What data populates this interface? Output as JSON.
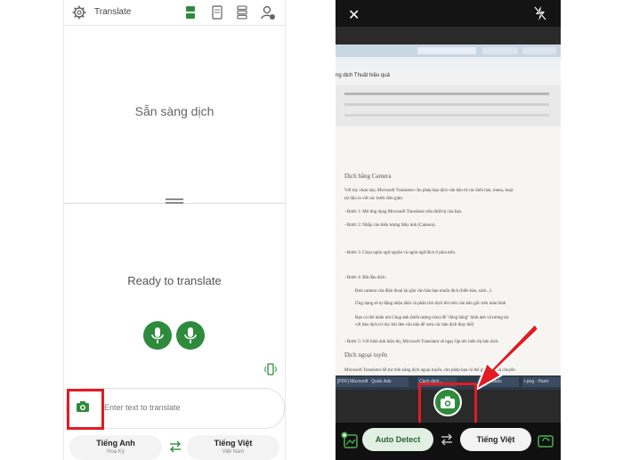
{
  "left_screen": {
    "header": {
      "title": "Translate",
      "icons": [
        "gear-icon",
        "conversation-layout-icon",
        "single-view-icon",
        "stacked-view-icon",
        "profile-settings-icon"
      ]
    },
    "top_pane": {
      "status_text": "Sẵn sàng dịch"
    },
    "bottom_pane": {
      "status_text": "Ready to translate"
    },
    "input": {
      "placeholder": "Enter text to translate",
      "icon": "camera-icon"
    },
    "languages": {
      "source": {
        "name": "Tiếng Anh",
        "region": "Hoa Kỳ"
      },
      "target": {
        "name": "Tiếng Việt",
        "region": "Việt Nam"
      }
    }
  },
  "right_screen": {
    "photographed_document": {
      "heading": "Dịch bằng Camera",
      "lines": [
        "Với tùy chọn này, Microsoft Translator cho phép bạn dịch văn bản từ các biển báo, menu, hoặc",
        "tài liệu in với các bước đơn giản:",
        "- Bước 1: Mở ứng dụng Microsoft Translator trên thiết bị của bạn.",
        "- Bước 2: Nhấp vào biểu tượng Máy ảnh (Camera).",
        "- Bước 3: Chọn ngôn ngữ nguồn và ngôn ngữ đích ở phía trên.",
        "- Bước 4: Bắt đầu dịch:",
        "Đưa camera của điện thoại lại gần văn bản bạn muốn dịch (biển báo, sách...)",
        "Ứng dụng sẽ tự động nhận diện và phân tích dịch lên trên văn bản gốc trên màn hình",
        "Bạn có thể nhấn nút Chụp ảnh (biểu tượng tròn) để \"đóng băng\" hình ảnh và tương tác",
        "với bản dịch (ví dụ: bôi đen văn bản để xem các bản dịch thay thế)",
        "- Bước 5: Với hình ảnh hiện thị, Microsoft Translator sẽ ngay lập tức hiển thị bản dịch.",
        "Dịch ngoại tuyến",
        "Microsoft Translator hỗ trợ tính năng dịch ngoại tuyến, cho phép bạn có thể giao tiếp và chuyển"
      ],
      "doc_title": "ng dịch Thuật hiệu quả",
      "tabs": [
        "[PDF] Microsoft Translator",
        "Quick Ads",
        "Đăng nhập",
        "Cách dịch...",
        "Downloads",
        "t.png - Paint"
      ]
    },
    "controls": {
      "close_icon": "close-icon",
      "flash_icon": "flash-off-icon",
      "shutter_icon": "camera-icon",
      "source_button": "Auto Detect",
      "target_button": "Tiếng Việt"
    }
  },
  "colors": {
    "accent_green": "#2e8b3c",
    "highlight_red": "#e31b23",
    "auto_detect_bg": "#e2f0e4"
  }
}
